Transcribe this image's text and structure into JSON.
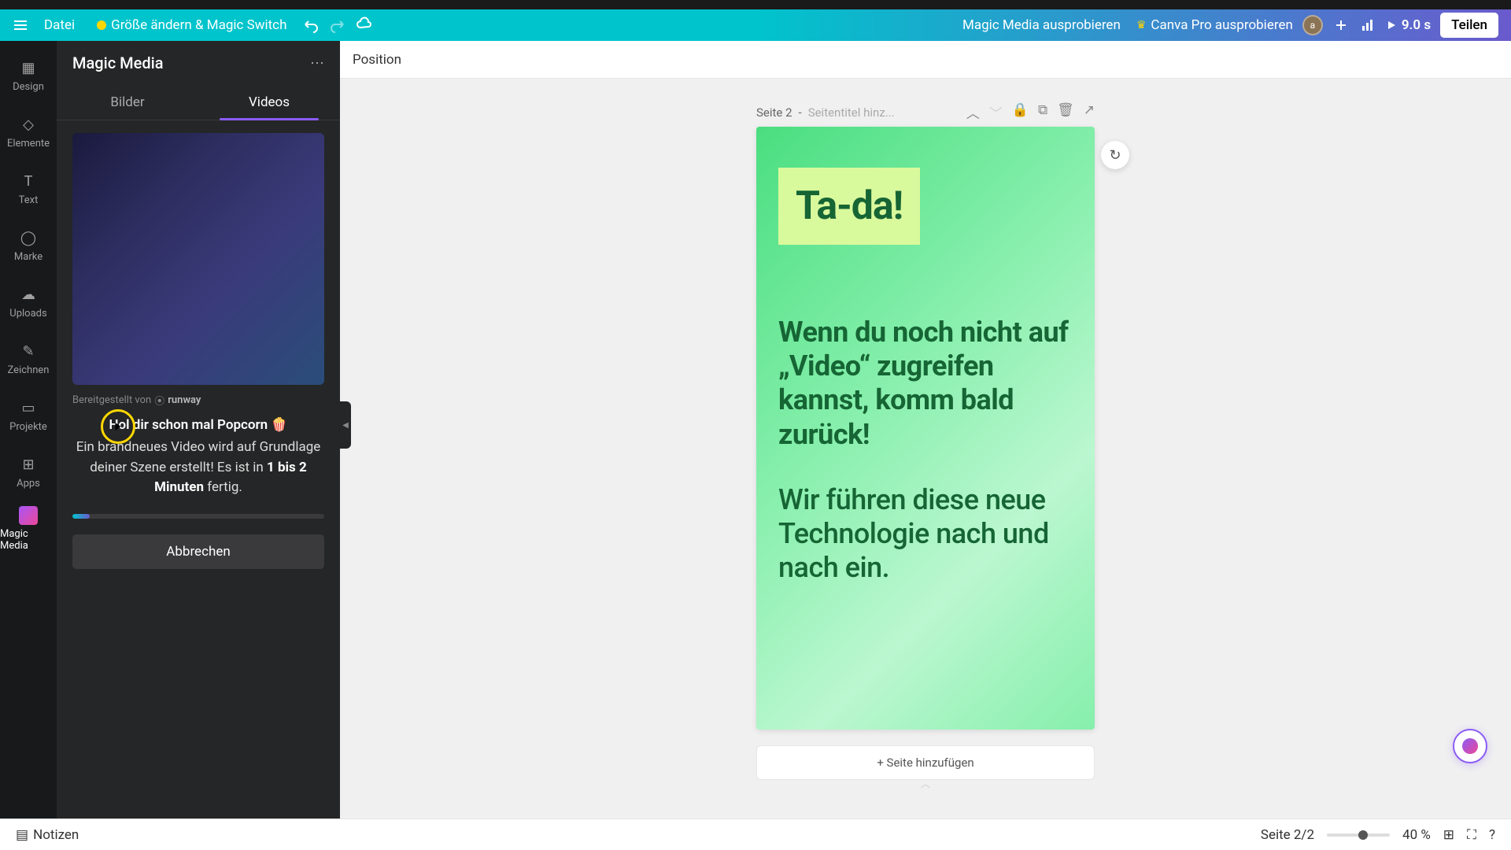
{
  "top": {
    "file": "Datei",
    "resize": "Größe ändern & Magic Switch",
    "try_magic": "Magic Media ausprobieren",
    "try_pro": "Canva Pro ausprobieren",
    "avatar_letter": "a",
    "duration": "9.0 s",
    "share": "Teilen"
  },
  "rail": {
    "design": "Design",
    "elements": "Elemente",
    "text": "Text",
    "brand": "Marke",
    "uploads": "Uploads",
    "draw": "Zeichnen",
    "projects": "Projekte",
    "apps": "Apps",
    "magic": "Magic Media"
  },
  "panel": {
    "title": "Magic Media",
    "tab_images": "Bilder",
    "tab_videos": "Videos",
    "provided_by": "Bereitgestellt von",
    "provider": "runway",
    "headline": "Hol dir schon mal Popcorn 🍿",
    "desc1": "Ein brandneues Video wird auf Grundlage deiner Szene erstellt! Es ist in ",
    "desc_bold": "1 bis 2 Minuten",
    "desc2": " fertig.",
    "cancel": "Abbrechen"
  },
  "context": {
    "position": "Position"
  },
  "page": {
    "label": "Seite 2",
    "separator": " - ",
    "title_placeholder": "Seitentitel hinz...",
    "tada": "Ta-da!",
    "body1": "Wenn du noch nicht auf „Video“ zugreifen kannst, komm bald zurück!",
    "body2": "Wir führen diese neue Technologie nach und nach ein.",
    "add_page": "+ Seite hinzufügen"
  },
  "bottom": {
    "notes": "Notizen",
    "page_indicator": "Seite 2/2",
    "zoom": "40 %"
  }
}
